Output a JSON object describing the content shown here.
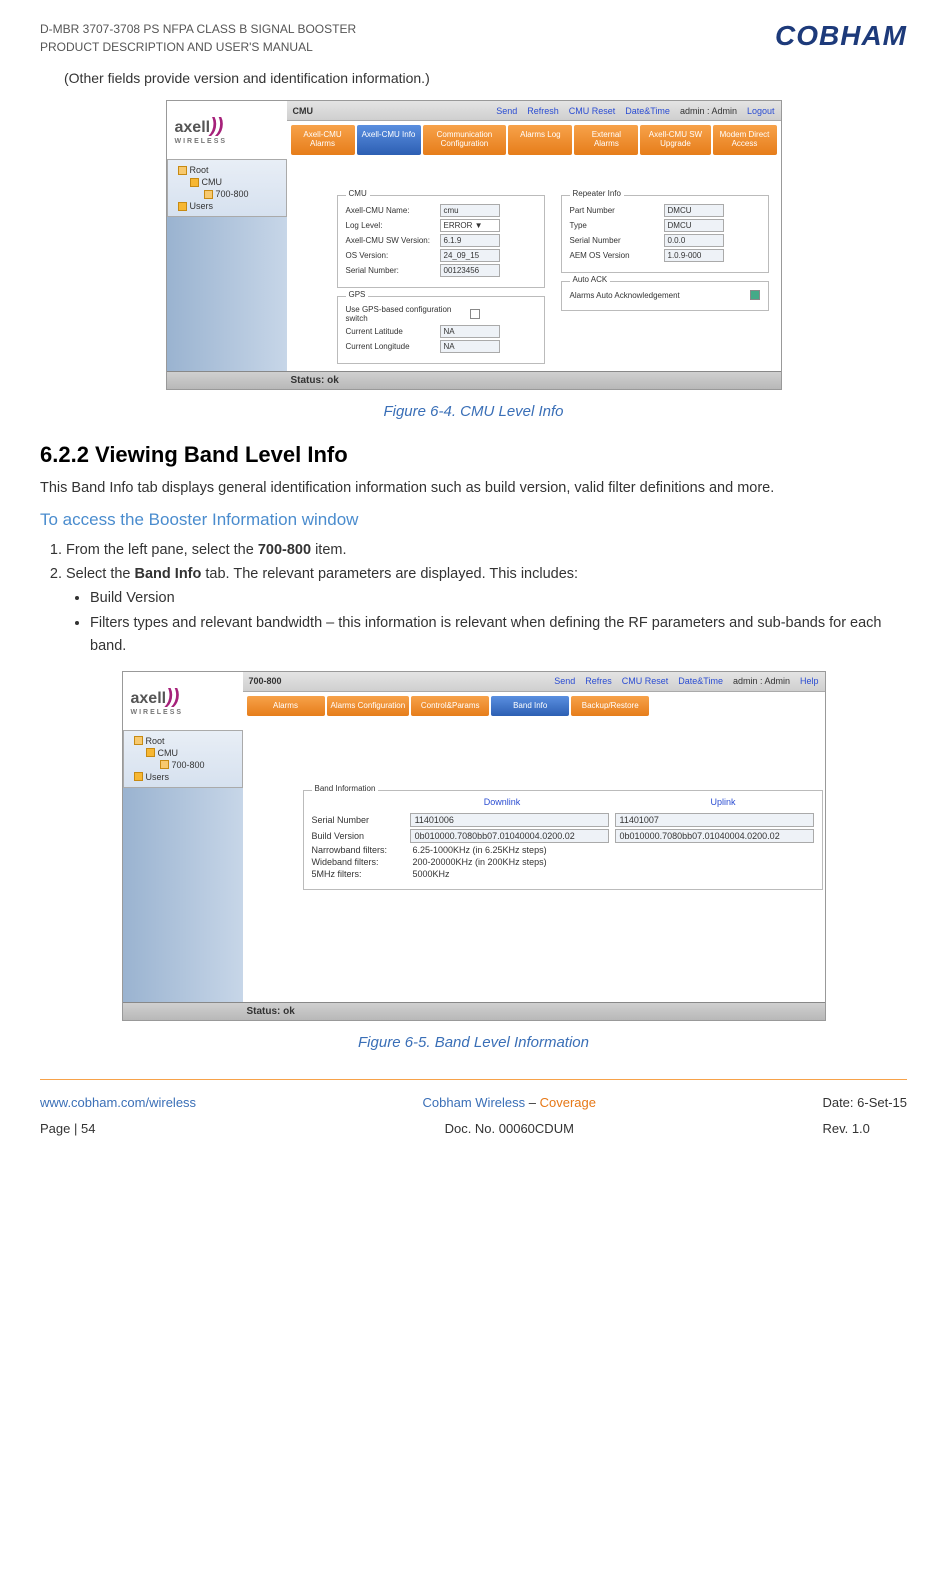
{
  "header": {
    "line1": "D-MBR 3707-3708 PS NFPA CLASS B SIGNAL BOOSTER",
    "line2": "PRODUCT DESCRIPTION AND USER'S MANUAL",
    "brand": "COBHAM"
  },
  "intro_note": "(Other fields provide version and identification information.)",
  "figure1_caption": "Figure 6-4. CMU Level Info",
  "figure2_caption": "Figure 6-5. Band Level Information",
  "heading": "6.2.2   Viewing Band Level Info",
  "para1": "This Band Info tab displays general identification information such as build version, valid filter definitions and more.",
  "subheading": "To access the Booster Information window",
  "steps": {
    "s1_a": "From the left pane, select the ",
    "s1_b": "700-800",
    "s1_c": " item.",
    "s2_a": "Select the ",
    "s2_b": "Band Info",
    "s2_c": " tab. The relevant parameters are displayed. This includes:"
  },
  "bullets": {
    "b1": "Build Version",
    "b2": "Filters types and relevant bandwidth – this information is relevant when defining the RF parameters and sub-bands for each band."
  },
  "ss1": {
    "topbar_title": "CMU",
    "topbar": {
      "send": "Send",
      "refresh": "Refresh",
      "reset": "CMU Reset",
      "datetime": "Date&Time",
      "admin_label": "admin : Admin",
      "logout": "Logout"
    },
    "tabs": [
      "Axell-CMU Alarms",
      "Axell-CMU Info",
      "Communication Configuration",
      "Alarms Log",
      "External Alarms",
      "Axell-CMU SW Upgrade",
      "Modem Direct Access"
    ],
    "tree": {
      "root": "Root",
      "cmu": "CMU",
      "band": "700-800",
      "users": "Users"
    },
    "cmu_legend": "CMU",
    "cmu_rows": {
      "name_l": "Axell-CMU Name:",
      "name_v": "cmu",
      "log_l": "Log Level:",
      "log_v": "ERROR   ▼",
      "swv_l": "Axell-CMU SW Version:",
      "swv_v": "6.1.9",
      "os_l": "OS Version:",
      "os_v": "24_09_15",
      "sn_l": "Serial Number:",
      "sn_v": "00123456"
    },
    "gps_legend": "GPS",
    "gps_rows": {
      "use_l": "Use GPS-based configuration switch",
      "lat_l": "Current Latitude",
      "lat_v": "NA",
      "lon_l": "Current Longitude",
      "lon_v": "NA"
    },
    "rep_legend": "Repeater Info",
    "rep_rows": {
      "pn_l": "Part Number",
      "pn_v": "DMCU",
      "type_l": "Type",
      "type_v": "DMCU",
      "sn_l": "Serial Number",
      "sn_v": "0.0.0",
      "aem_l": "AEM OS Version",
      "aem_v": "1.0.9-000"
    },
    "ack_legend": "Auto ACK",
    "ack_label": "Alarms Auto Acknowledgement",
    "status": "Status: ok"
  },
  "ss2": {
    "topbar_title": "700-800",
    "topbar": {
      "send": "Send",
      "refresh": "Refres",
      "reset": "CMU Reset",
      "datetime": "Date&Time",
      "admin_label": "admin : Admin",
      "help": "Help"
    },
    "tabs": [
      "Alarms",
      "Alarms Configuration",
      "Control&Params",
      "Band Info",
      "Backup/Restore"
    ],
    "tree": {
      "root": "Root",
      "cmu": "CMU",
      "band": "700-800",
      "users": "Users"
    },
    "legend": "Band Information",
    "downlink": "Downlink",
    "uplink": "Uplink",
    "rows": {
      "sn_l": "Serial Number",
      "sn_dl": "11401006",
      "sn_ul": "11401007",
      "bv_l": "Build Version",
      "bv_dl": "0b010000.7080bb07.01040004.0200.02",
      "bv_ul": "0b010000.7080bb07.01040004.0200.02",
      "nb_l": "Narrowband filters:",
      "nb_v": "6.25-1000KHz (in 6.25KHz steps)",
      "wb_l": "Wideband filters:",
      "wb_v": "200-20000KHz (in 200KHz steps)",
      "f5_l": "5MHz filters:",
      "f5_v": "5000KHz"
    },
    "status": "Status: ok"
  },
  "footer": {
    "url": "www.cobham.com/wireless",
    "page": "Page | 54",
    "center1a": "Cobham Wireless",
    "center1b": " – ",
    "center1c": "Coverage",
    "center2": "Doc. No. 00060CDUM",
    "date": "Date: 6-Set-15",
    "rev": "Rev. 1.0"
  }
}
